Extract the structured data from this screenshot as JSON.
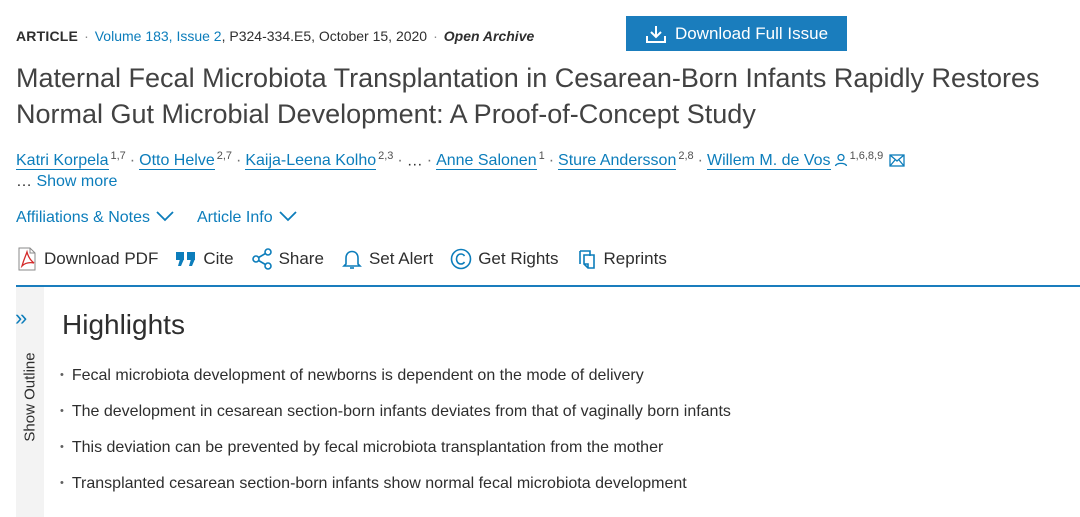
{
  "meta": {
    "type": "ARTICLE",
    "sep": "·",
    "volume_issue": "Volume 183, Issue 2",
    "pages_date": ", P324-334.E5, October 15, 2020",
    "access": "Open Archive"
  },
  "download_issue": {
    "label": "Download Full Issue",
    "icon": "download-icon",
    "color": "#1a7dbd"
  },
  "title": "Maternal Fecal Microbiota Transplantation in Cesarean-Born Infants Rapidly Restores Normal Gut Microbial Development: A Proof-of-Concept Study",
  "authors": [
    {
      "name": "Katri Korpela",
      "aff": "1,7"
    },
    {
      "name": "Otto Helve",
      "aff": "2,7"
    },
    {
      "name": "Kaija-Leena Kolho",
      "aff": "2,3"
    },
    {
      "name": "Anne Salonen",
      "aff": "1"
    },
    {
      "name": "Sture Andersson",
      "aff": "2,8"
    },
    {
      "name": "Willem M. de Vos",
      "aff": "1,6,8,9"
    }
  ],
  "authors_ellipsis": "…",
  "show_more": {
    "prefix": "…",
    "label": "Show more"
  },
  "expanders": [
    {
      "label": "Affiliations & Notes"
    },
    {
      "label": "Article Info"
    }
  ],
  "toolbar": [
    {
      "label": "Download PDF",
      "icon": "pdf-icon"
    },
    {
      "label": "Cite",
      "icon": "quote-icon"
    },
    {
      "label": "Share",
      "icon": "share-icon"
    },
    {
      "label": "Set Alert",
      "icon": "bell-icon"
    },
    {
      "label": "Get Rights",
      "icon": "copyright-icon"
    },
    {
      "label": "Reprints",
      "icon": "reprints-icon"
    }
  ],
  "outline": {
    "label": "Show Outline",
    "chevron": "»"
  },
  "highlights": {
    "title": "Highlights",
    "bullet": "•",
    "items": [
      "Fecal microbiota development of newborns is dependent on the mode of delivery",
      "The development in cesarean section-born infants deviates from that of vaginally born infants",
      "This deviation can be prevented by fecal microbiota transplantation from the mother",
      "Transplanted cesarean section-born infants show normal fecal microbiota development"
    ]
  },
  "colors": {
    "accent": "#0c7dbb",
    "button": "#1a7dbd",
    "pdf_red": "#d42a2a"
  }
}
